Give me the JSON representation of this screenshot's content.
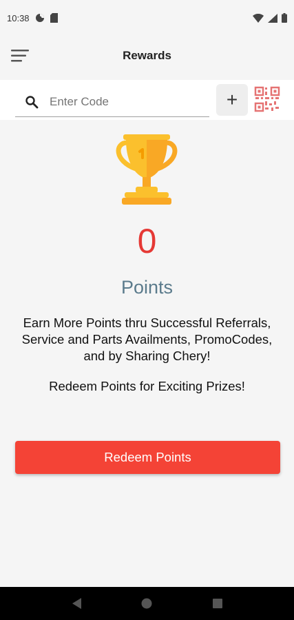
{
  "status_bar": {
    "time": "10:38",
    "icons": [
      "data-saver-icon",
      "sd-card-icon",
      "wifi-icon",
      "signal-icon",
      "battery-icon"
    ]
  },
  "app_bar": {
    "title": "Rewards",
    "menu_icon": "hamburger-menu-icon"
  },
  "code_entry": {
    "placeholder": "Enter Code",
    "value": "",
    "search_icon": "search-icon",
    "add_label": "+",
    "qr_icon": "qr-code-icon"
  },
  "rewards": {
    "icon": "trophy-icon",
    "points": "0",
    "points_label": "Points",
    "description": "Earn More Points thru Successful Referrals, Service and Parts Availments, PromoCodes, and by Sharing Chery!",
    "redeem_note": "Redeem Points for Exciting Prizes!"
  },
  "actions": {
    "redeem_label": "Redeem Points"
  },
  "nav_bar": {
    "buttons": [
      "back-icon",
      "home-icon",
      "recents-icon"
    ]
  },
  "colors": {
    "accent": "#f44336",
    "points_value": "#e53935",
    "points_label": "#5b7b8c",
    "trophy": "#fbc02d"
  }
}
